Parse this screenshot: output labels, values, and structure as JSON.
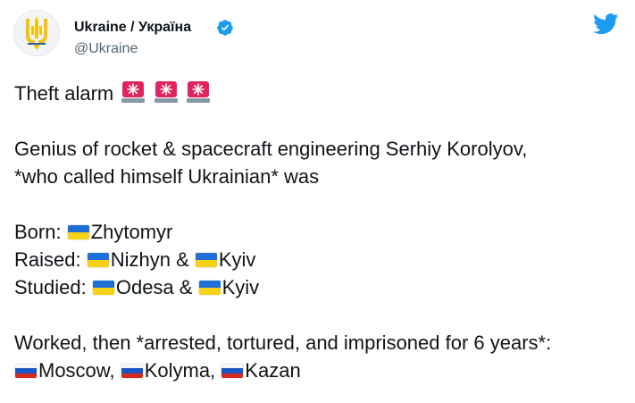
{
  "header": {
    "display_name": "Ukraine / Україна",
    "handle": "@Ukraine",
    "verified": true,
    "icons": {
      "avatar": "ukraine-trident-icon",
      "verified": "verified-badge-icon",
      "brand": "twitter-bird-icon"
    }
  },
  "colors": {
    "brand": "#1d9bf0",
    "text": "#0f1419",
    "secondary_text": "#536471",
    "ua_blue": "#1f6fd6",
    "ua_yellow": "#f7d117",
    "ru_red": "#d52b1e"
  },
  "tweet": {
    "line1": "Theft alarm",
    "line1_emoji": "police-car-light-icon",
    "line1_emoji_count": 3,
    "line2": "Genius of rocket & spacecraft engineering Serhiy Korolyov,",
    "line3": "*who called himself Ukrainian* was",
    "born_label": "Born: ",
    "born_place": "Zhytomyr",
    "raised_label": "Raised: ",
    "raised_place1": "Nizhyn & ",
    "raised_place2": "Kyiv",
    "studied_label": "Studied: ",
    "studied_place1": "Odesa & ",
    "studied_place2": "Kyiv",
    "worked_line": "Worked, then *arrested, tortured, and imprisoned for 6 years*:",
    "ru_place1": "Moscow, ",
    "ru_place2": "Kolyma, ",
    "ru_place3": "Kazan",
    "flag_ukraine": "flag-ukraine-icon",
    "flag_russia": "flag-russia-icon"
  }
}
